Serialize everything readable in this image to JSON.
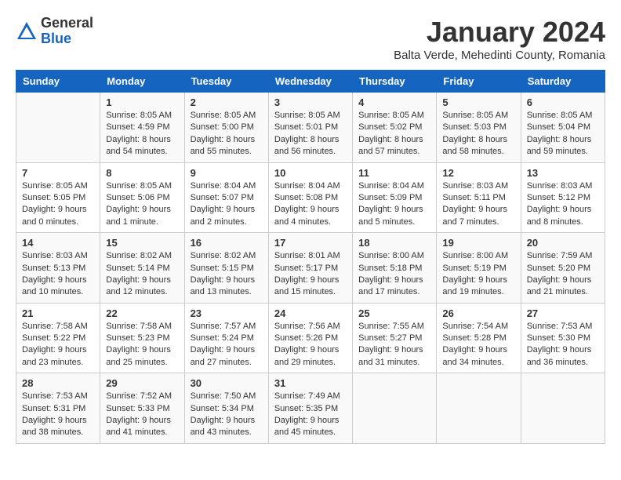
{
  "header": {
    "logo_general": "General",
    "logo_blue": "Blue",
    "month_title": "January 2024",
    "subtitle": "Balta Verde, Mehedinti County, Romania"
  },
  "days_of_week": [
    "Sunday",
    "Monday",
    "Tuesday",
    "Wednesday",
    "Thursday",
    "Friday",
    "Saturday"
  ],
  "weeks": [
    [
      {
        "day": "",
        "info": ""
      },
      {
        "day": "1",
        "info": "Sunrise: 8:05 AM\nSunset: 4:59 PM\nDaylight: 8 hours\nand 54 minutes."
      },
      {
        "day": "2",
        "info": "Sunrise: 8:05 AM\nSunset: 5:00 PM\nDaylight: 8 hours\nand 55 minutes."
      },
      {
        "day": "3",
        "info": "Sunrise: 8:05 AM\nSunset: 5:01 PM\nDaylight: 8 hours\nand 56 minutes."
      },
      {
        "day": "4",
        "info": "Sunrise: 8:05 AM\nSunset: 5:02 PM\nDaylight: 8 hours\nand 57 minutes."
      },
      {
        "day": "5",
        "info": "Sunrise: 8:05 AM\nSunset: 5:03 PM\nDaylight: 8 hours\nand 58 minutes."
      },
      {
        "day": "6",
        "info": "Sunrise: 8:05 AM\nSunset: 5:04 PM\nDaylight: 8 hours\nand 59 minutes."
      }
    ],
    [
      {
        "day": "7",
        "info": "Sunrise: 8:05 AM\nSunset: 5:05 PM\nDaylight: 9 hours\nand 0 minutes."
      },
      {
        "day": "8",
        "info": "Sunrise: 8:05 AM\nSunset: 5:06 PM\nDaylight: 9 hours\nand 1 minute."
      },
      {
        "day": "9",
        "info": "Sunrise: 8:04 AM\nSunset: 5:07 PM\nDaylight: 9 hours\nand 2 minutes."
      },
      {
        "day": "10",
        "info": "Sunrise: 8:04 AM\nSunset: 5:08 PM\nDaylight: 9 hours\nand 4 minutes."
      },
      {
        "day": "11",
        "info": "Sunrise: 8:04 AM\nSunset: 5:09 PM\nDaylight: 9 hours\nand 5 minutes."
      },
      {
        "day": "12",
        "info": "Sunrise: 8:03 AM\nSunset: 5:11 PM\nDaylight: 9 hours\nand 7 minutes."
      },
      {
        "day": "13",
        "info": "Sunrise: 8:03 AM\nSunset: 5:12 PM\nDaylight: 9 hours\nand 8 minutes."
      }
    ],
    [
      {
        "day": "14",
        "info": "Sunrise: 8:03 AM\nSunset: 5:13 PM\nDaylight: 9 hours\nand 10 minutes."
      },
      {
        "day": "15",
        "info": "Sunrise: 8:02 AM\nSunset: 5:14 PM\nDaylight: 9 hours\nand 12 minutes."
      },
      {
        "day": "16",
        "info": "Sunrise: 8:02 AM\nSunset: 5:15 PM\nDaylight: 9 hours\nand 13 minutes."
      },
      {
        "day": "17",
        "info": "Sunrise: 8:01 AM\nSunset: 5:17 PM\nDaylight: 9 hours\nand 15 minutes."
      },
      {
        "day": "18",
        "info": "Sunrise: 8:00 AM\nSunset: 5:18 PM\nDaylight: 9 hours\nand 17 minutes."
      },
      {
        "day": "19",
        "info": "Sunrise: 8:00 AM\nSunset: 5:19 PM\nDaylight: 9 hours\nand 19 minutes."
      },
      {
        "day": "20",
        "info": "Sunrise: 7:59 AM\nSunset: 5:20 PM\nDaylight: 9 hours\nand 21 minutes."
      }
    ],
    [
      {
        "day": "21",
        "info": "Sunrise: 7:58 AM\nSunset: 5:22 PM\nDaylight: 9 hours\nand 23 minutes."
      },
      {
        "day": "22",
        "info": "Sunrise: 7:58 AM\nSunset: 5:23 PM\nDaylight: 9 hours\nand 25 minutes."
      },
      {
        "day": "23",
        "info": "Sunrise: 7:57 AM\nSunset: 5:24 PM\nDaylight: 9 hours\nand 27 minutes."
      },
      {
        "day": "24",
        "info": "Sunrise: 7:56 AM\nSunset: 5:26 PM\nDaylight: 9 hours\nand 29 minutes."
      },
      {
        "day": "25",
        "info": "Sunrise: 7:55 AM\nSunset: 5:27 PM\nDaylight: 9 hours\nand 31 minutes."
      },
      {
        "day": "26",
        "info": "Sunrise: 7:54 AM\nSunset: 5:28 PM\nDaylight: 9 hours\nand 34 minutes."
      },
      {
        "day": "27",
        "info": "Sunrise: 7:53 AM\nSunset: 5:30 PM\nDaylight: 9 hours\nand 36 minutes."
      }
    ],
    [
      {
        "day": "28",
        "info": "Sunrise: 7:53 AM\nSunset: 5:31 PM\nDaylight: 9 hours\nand 38 minutes."
      },
      {
        "day": "29",
        "info": "Sunrise: 7:52 AM\nSunset: 5:33 PM\nDaylight: 9 hours\nand 41 minutes."
      },
      {
        "day": "30",
        "info": "Sunrise: 7:50 AM\nSunset: 5:34 PM\nDaylight: 9 hours\nand 43 minutes."
      },
      {
        "day": "31",
        "info": "Sunrise: 7:49 AM\nSunset: 5:35 PM\nDaylight: 9 hours\nand 45 minutes."
      },
      {
        "day": "",
        "info": ""
      },
      {
        "day": "",
        "info": ""
      },
      {
        "day": "",
        "info": ""
      }
    ]
  ]
}
